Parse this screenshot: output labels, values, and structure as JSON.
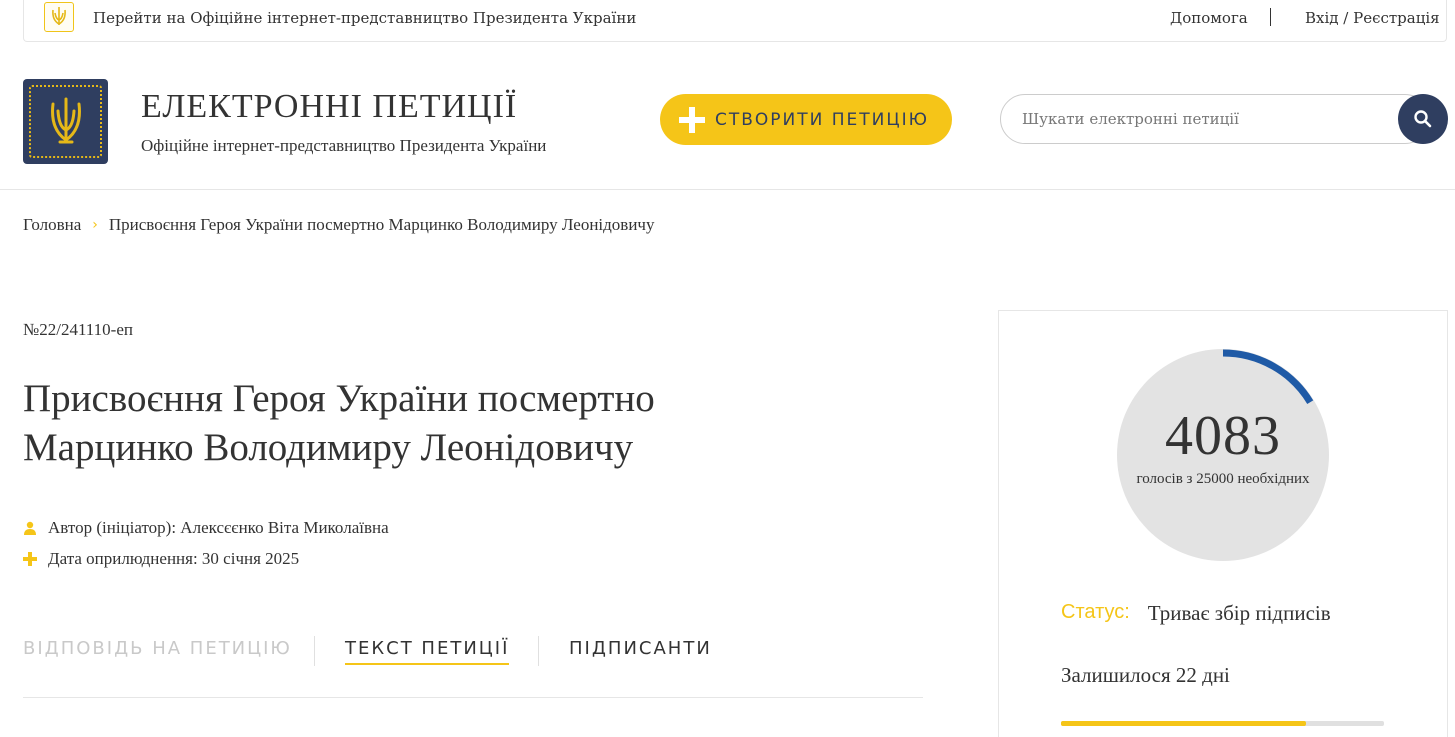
{
  "topbar": {
    "president_link": "Перейти на Офіційне інтернет-представництво Президента України",
    "help": "Допомога",
    "login": "Вхід / Реєстрація"
  },
  "header": {
    "title": "ЕЛЕКТРОННІ ПЕТИЦІЇ",
    "subtitle": "Офіційне інтернет-представництво Президента України",
    "create_button": "СТВОРИТИ ПЕТИЦІЮ",
    "search_placeholder": "Шукати електронні петиції"
  },
  "breadcrumb": {
    "home": "Головна",
    "current": "Присвоєння Героя України посмертно Марцинко Володимиру Леонідовичу"
  },
  "petition": {
    "number": "№22/241110-еп",
    "title": "Присвоєння Героя України посмертно Марцинко Володимиру Леонідовичу",
    "author": "Автор (ініціатор): Алексєєнко Віта Миколаївна",
    "published": "Дата оприлюднення: 30 січня 2025"
  },
  "tabs": [
    {
      "label": "ВІДПОВІДЬ НА ПЕТИЦІЮ",
      "state": "disabled"
    },
    {
      "label": "ТЕКСТ ПЕТИЦІЇ",
      "state": "active"
    },
    {
      "label": "ПІДПИСАНТИ",
      "state": "default"
    }
  ],
  "votes": {
    "count": "4083",
    "caption": "голосів з 25000 необхідних",
    "count_value": 4083,
    "required_value": 25000
  },
  "status": {
    "label": "Статус:",
    "value": "Триває збір підписів"
  },
  "remaining": {
    "text": "Залишилося 22 дні",
    "elapsed_fraction": 0.76
  },
  "colors": {
    "accent_yellow": "#f5c518",
    "navy": "#2f3e60",
    "gauge_arc": "#1f5aa6",
    "gauge_bg": "#e3e3e3"
  },
  "icons": {
    "topbar_emblem": "trident-emblem-icon",
    "logo": "trident-logo-icon",
    "create": "plus-icon",
    "search": "search-icon",
    "author": "user-icon",
    "date": "plus-icon"
  }
}
